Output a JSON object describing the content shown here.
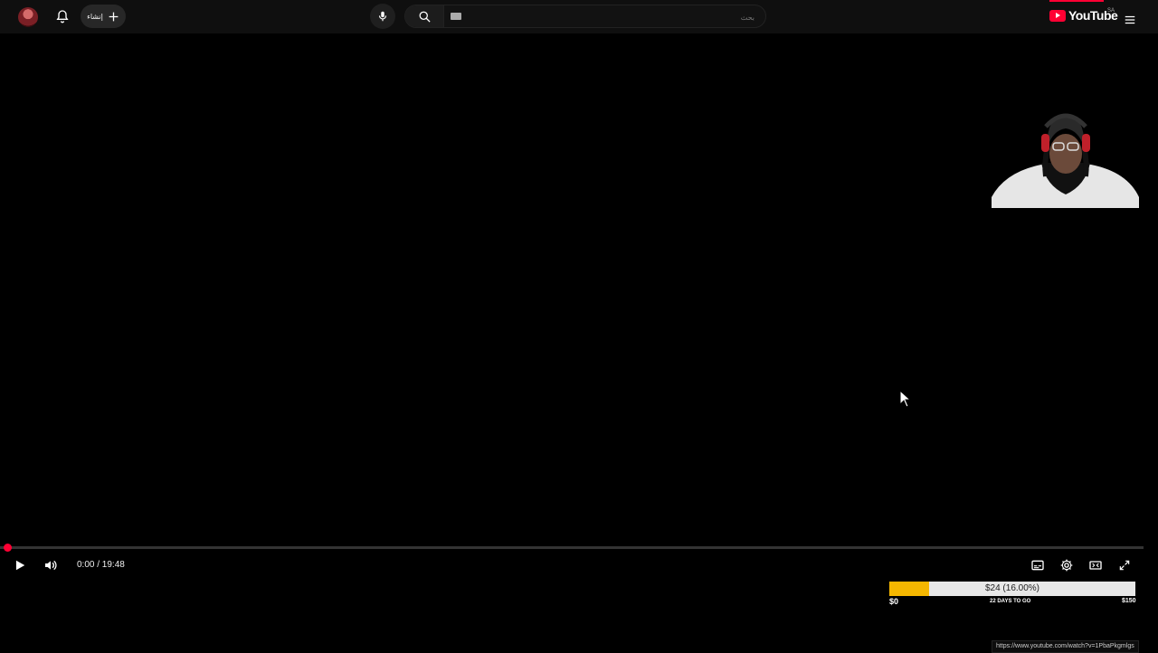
{
  "header": {
    "create_label": "إنشاء",
    "search_placeholder": "بحث",
    "logo_text": "YouTube",
    "country_code": "SA",
    "icons": [
      "bell-icon",
      "plus-icon",
      "mic-icon",
      "search-icon",
      "keyboard-icon",
      "menu-icon"
    ]
  },
  "player": {
    "time_display": "0:00 / 19:48",
    "progress_fraction": 0,
    "accent_color": "#ff0033",
    "controls": [
      "play-icon",
      "volume-icon",
      "subtitles-icon",
      "settings-icon",
      "theater-icon",
      "fullscreen-icon"
    ]
  },
  "donation": {
    "amount_label": "$24 (16.00%)",
    "fraction": 0.16,
    "start_label": "$0",
    "days_label": "22 DAYS TO GO",
    "goal_label": "$150",
    "fill_color": "#f5b700"
  },
  "status_bar": {
    "url": "https://www.youtube.com/watch?v=1PbaPkgmlgs"
  }
}
